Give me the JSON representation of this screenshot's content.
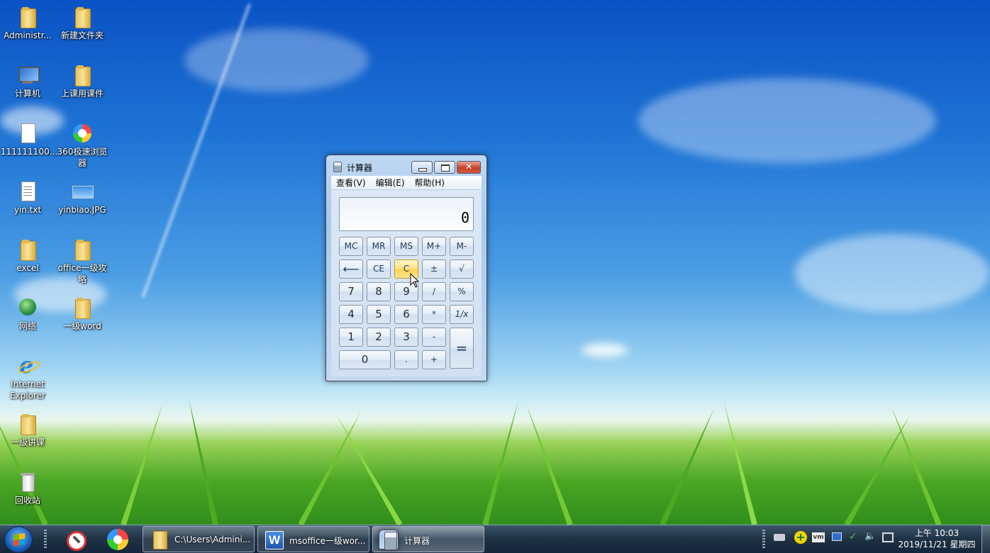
{
  "desktop": {
    "icons": [
      {
        "label": "Administr...",
        "icon": "user-folder-icon"
      },
      {
        "label": "新建文件夹",
        "icon": "folder-icon"
      },
      {
        "label": "计算机",
        "icon": "computer-icon"
      },
      {
        "label": "上课用课件",
        "icon": "folder-icon"
      },
      {
        "label": "111111100...",
        "icon": "document-icon"
      },
      {
        "label": "360极速浏览器",
        "icon": "browser-360-icon"
      },
      {
        "label": "yin.txt",
        "icon": "text-file-icon"
      },
      {
        "label": "yinbiao.JPG",
        "icon": "image-file-icon"
      },
      {
        "label": "excel",
        "icon": "folder-icon"
      },
      {
        "label": "office一级攻略",
        "icon": "folder-icon"
      },
      {
        "label": "网络",
        "icon": "network-icon"
      },
      {
        "label": "一级word",
        "icon": "folder-icon"
      },
      {
        "label": "Internet Explorer",
        "icon": "internet-explorer-icon"
      },
      {
        "label": "一级讲课",
        "icon": "folder-icon"
      },
      {
        "label": "回收站",
        "icon": "recycle-bin-icon"
      }
    ]
  },
  "calculator": {
    "title": "计算器",
    "menu": [
      "查看(V)",
      "编辑(E)",
      "帮助(H)"
    ],
    "display": "0",
    "keys": {
      "mc": "MC",
      "mr": "MR",
      "ms": "MS",
      "mplus": "M+",
      "mminus": "M-",
      "backspace": "⟵",
      "ce": "CE",
      "c": "C",
      "plusminus": "±",
      "sqrt": "√",
      "seven": "7",
      "eight": "8",
      "nine": "9",
      "divide": "/",
      "percent": "%",
      "four": "4",
      "five": "5",
      "six": "6",
      "multiply": "*",
      "reciprocal": "1/x",
      "one": "1",
      "two": "2",
      "three": "3",
      "minus": "-",
      "equals": "=",
      "zero": "0",
      "decimal": ".",
      "plus": "+"
    },
    "highlighted_key": "C"
  },
  "taskbar": {
    "tasks": [
      {
        "label": "C:\\Users\\Admini...",
        "icon": "folder-icon"
      },
      {
        "label": "msoffice一级wor...",
        "icon": "word-icon"
      },
      {
        "label": "计算器",
        "icon": "calculator-icon"
      }
    ],
    "clock": {
      "time": "上午 10:03",
      "date": "2019/11/21 星期四"
    }
  }
}
